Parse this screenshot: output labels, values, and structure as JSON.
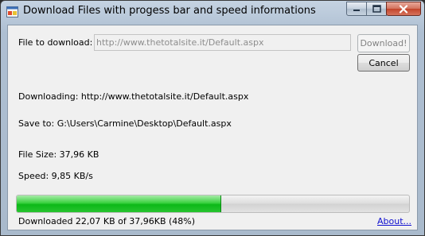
{
  "window": {
    "title": "Download Files with progess bar and speed informations",
    "icon": "app-window-icon",
    "controls": {
      "minimize_icon": "minimize-icon",
      "maximize_icon": "maximize-icon",
      "close_icon": "close-icon"
    }
  },
  "form": {
    "file_label": "File to download:",
    "url_value": "http://www.thetotalsite.it/Default.aspx",
    "download_button": "Download!",
    "cancel_button": "Cancel",
    "downloading": "Downloading: http://www.thetotalsite.it/Default.aspx",
    "save_to": "Save to: G:\\Users\\Carmine\\Desktop\\Default.aspx",
    "file_size": "File Size: 37,96 KB",
    "speed": "Speed: 9,85 KB/s",
    "progress_percent": 52,
    "downloaded": "Downloaded 22,07 KB of 37,96KB (48%)",
    "about_link": "About..."
  },
  "colors": {
    "progress_fill": "#0cb818",
    "link": "#0f0fcf",
    "close_button": "#c2432a"
  }
}
